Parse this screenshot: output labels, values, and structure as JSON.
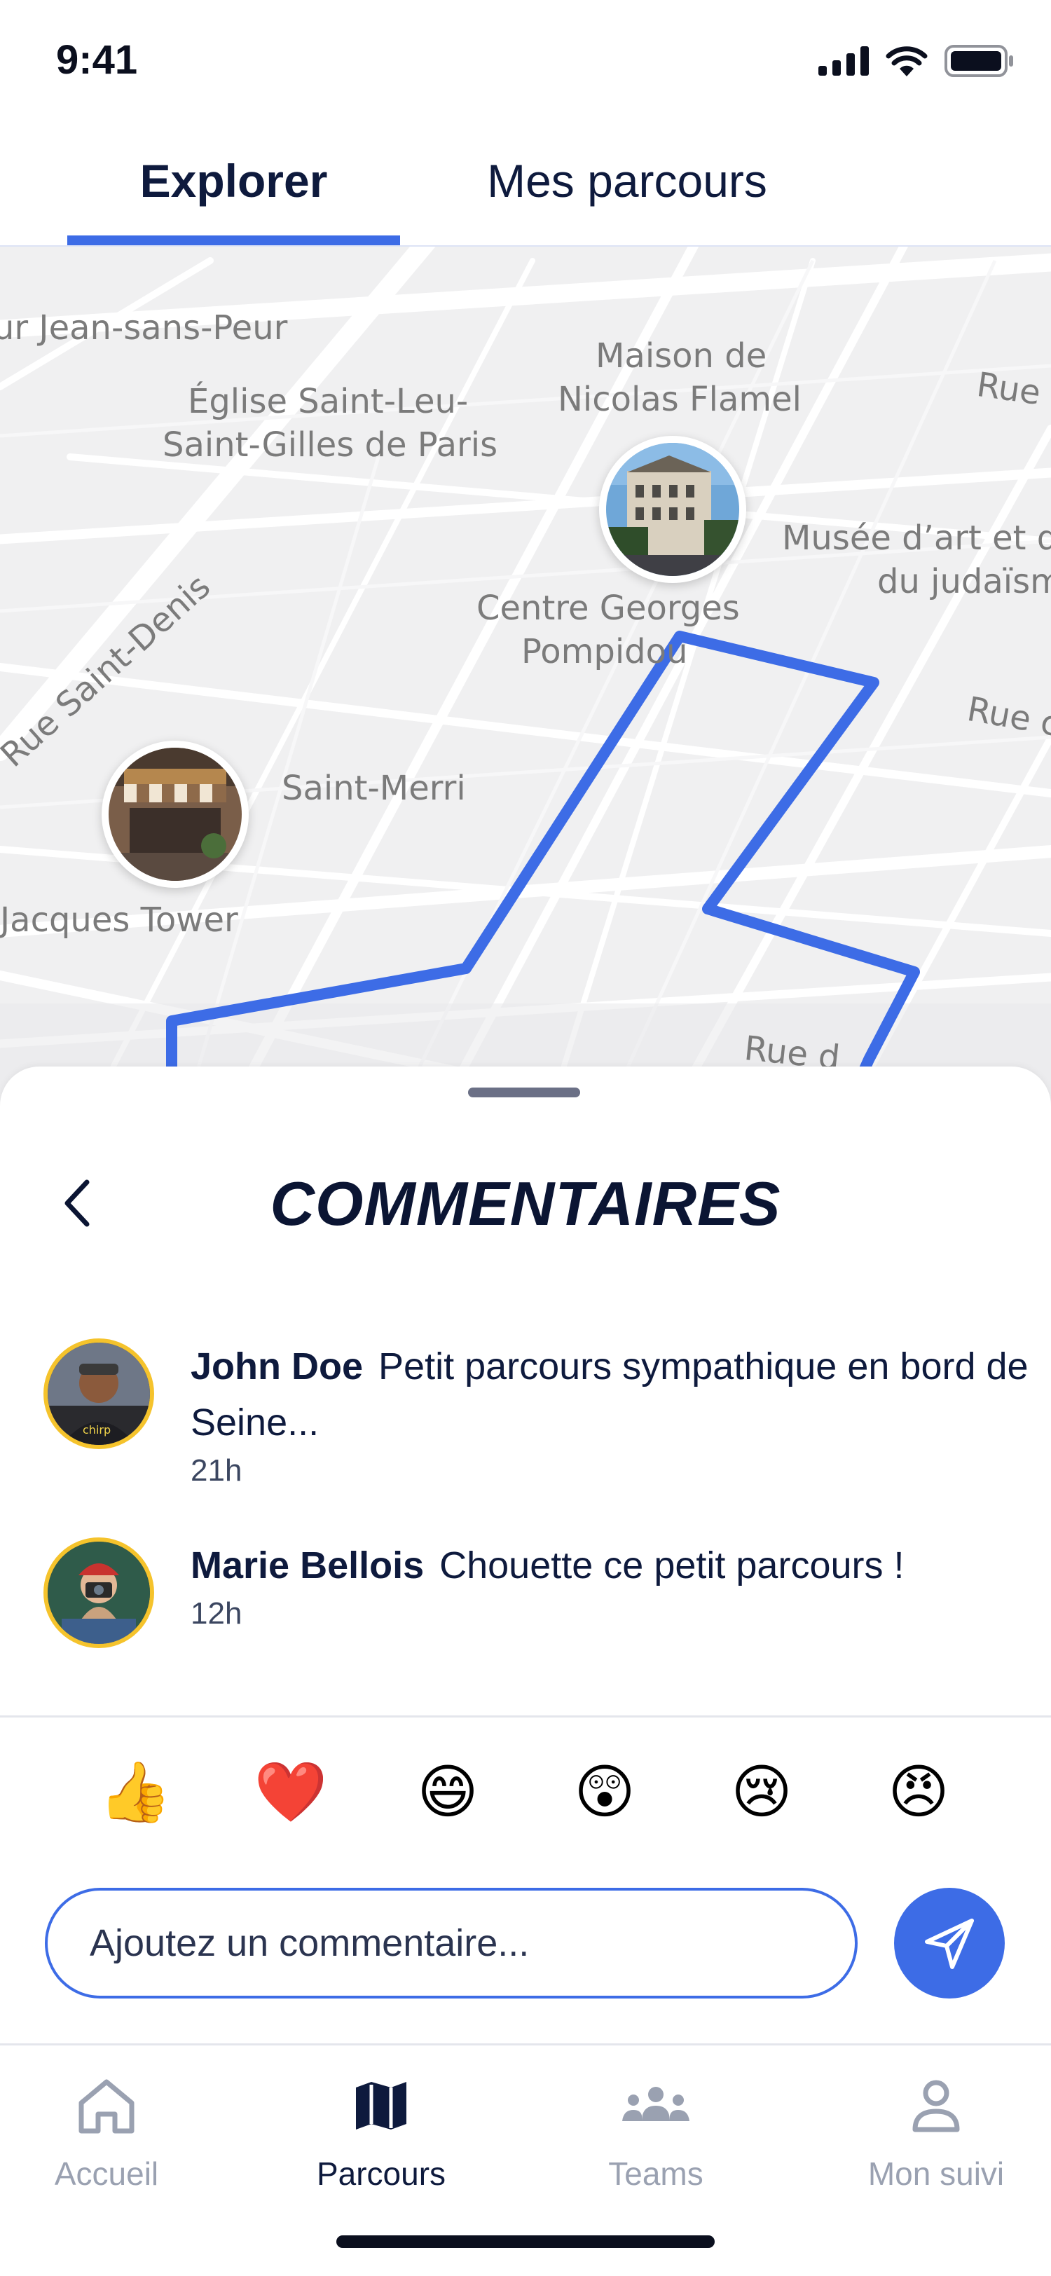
{
  "status_bar": {
    "time": "9:41"
  },
  "tabs": [
    {
      "label": "Explorer",
      "active": true
    },
    {
      "label": "Mes parcours",
      "active": false
    }
  ],
  "map": {
    "labels": {
      "jean_sans_peur": "ur Jean-sans-Peur",
      "eglise_1": "Église Saint-Leu-",
      "eglise_2": "Saint-Gilles de Paris",
      "maison_1": "Maison de",
      "maison_2": "Nicolas Flamel",
      "rue_right": "Rue",
      "musee_1": "Musée d’art et d’",
      "musee_2": "du judaïsm",
      "rue_saint_denis": "Rue Saint-Denis",
      "pompidou_1": "Centre Georges",
      "pompidou_2": "Pompidou",
      "rue_right_2": "Rue c",
      "saint_merri": "Saint-Merri",
      "jacques_tower": "Jacques Tower",
      "rue_bottom": "Rue d"
    },
    "route_color": "#3d6ce6",
    "pins": [
      "building-photo",
      "cafe-photo"
    ]
  },
  "sheet": {
    "title": "COMMENTAIRES",
    "comments": [
      {
        "author": "John Doe",
        "text": "Petit parcours sympathique en bord de Seine...",
        "time": "21h"
      },
      {
        "author": "Marie Bellois",
        "text": "Chouette ce petit parcours !",
        "time": "12h"
      }
    ],
    "reactions": [
      "👍",
      "❤️",
      "😄",
      "😲",
      "😢",
      "😠"
    ],
    "input_placeholder": "Ajoutez un commentaire..."
  },
  "nav": [
    {
      "label": "Accueil",
      "icon": "home-icon",
      "active": false
    },
    {
      "label": "Parcours",
      "icon": "map-icon",
      "active": true
    },
    {
      "label": "Teams",
      "icon": "teams-icon",
      "active": false
    },
    {
      "label": "Mon suivi",
      "icon": "user-icon",
      "active": false
    }
  ],
  "colors": {
    "accent": "#3d6ce6",
    "text_dark": "#0e1a3d",
    "avatar_border": "#f5c32c",
    "nav_inactive": "#9aa1b1"
  }
}
